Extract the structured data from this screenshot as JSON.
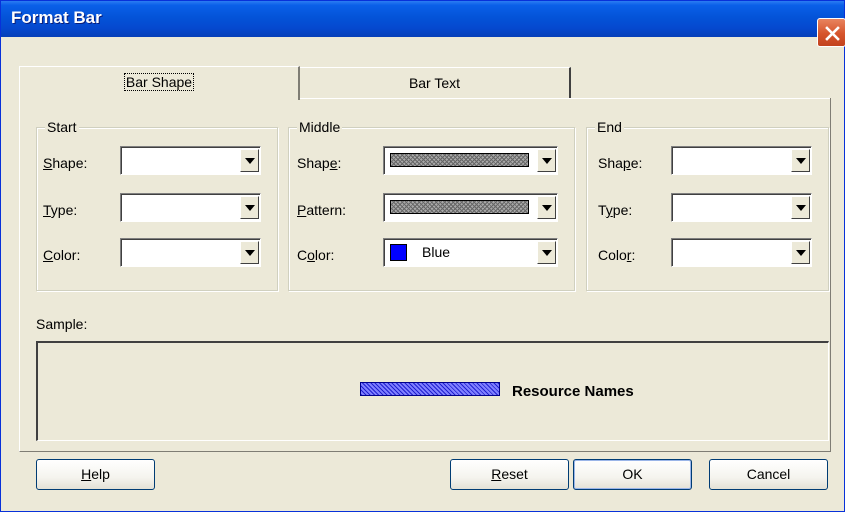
{
  "window": {
    "title": "Format Bar"
  },
  "tabs": [
    {
      "label": "Bar Shape",
      "active": true
    },
    {
      "label": "Bar Text",
      "active": false
    }
  ],
  "groups": {
    "start": {
      "title": "Start",
      "shape_label": {
        "pre": "",
        "key": "S",
        "post": "hape:"
      },
      "type_label": {
        "pre": "",
        "key": "T",
        "post": "ype:"
      },
      "color_label": {
        "pre": "",
        "key": "C",
        "post": "olor:"
      },
      "shape_value": "",
      "type_value": "",
      "color_value": ""
    },
    "middle": {
      "title": "Middle",
      "shape_label": {
        "pre": "Shap",
        "key": "e",
        "post": ":"
      },
      "pattern_label": {
        "pre": "",
        "key": "P",
        "post": "attern:"
      },
      "color_label": {
        "pre": "C",
        "key": "o",
        "post": "lor:"
      },
      "shape_value": "pattern-bar",
      "pattern_value": "pattern-bar",
      "color_value": "Blue",
      "color_hex": "#0000ff"
    },
    "end": {
      "title": "End",
      "shape_label": {
        "pre": "Sha",
        "key": "p",
        "post": "e:"
      },
      "type_label": {
        "pre": "T",
        "key": "y",
        "post": "pe:"
      },
      "color_label": {
        "pre": "Colo",
        "key": "r",
        "post": ":"
      },
      "shape_value": "",
      "type_value": "",
      "color_value": ""
    }
  },
  "sample": {
    "label": "Sample:",
    "bar_text": "Resource Names"
  },
  "buttons": {
    "help": {
      "key": "H",
      "rest": "elp"
    },
    "reset": {
      "key": "R",
      "rest": "eset"
    },
    "ok": "OK",
    "cancel": "Cancel"
  },
  "colors": {
    "title_bar": "#0453d8",
    "dialog_bg": "#ece9d8",
    "sample_bar": "#8080ff",
    "close_button": "#d6542c"
  }
}
